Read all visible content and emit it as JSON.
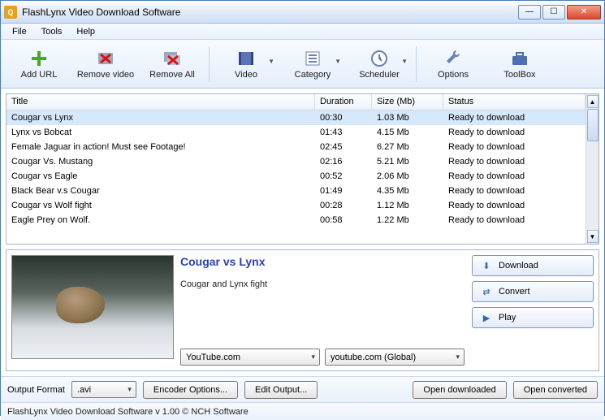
{
  "window": {
    "title": "FlashLynx Video Download Software"
  },
  "menu": {
    "file": "File",
    "tools": "Tools",
    "help": "Help"
  },
  "toolbar": {
    "add_url": "Add URL",
    "remove_video": "Remove video",
    "remove_all": "Remove All",
    "video": "Video",
    "category": "Category",
    "scheduler": "Scheduler",
    "options": "Options",
    "toolbox": "ToolBox"
  },
  "columns": {
    "title": "Title",
    "duration": "Duration",
    "size": "Size (Mb)",
    "status": "Status"
  },
  "rows": [
    {
      "title": "Cougar vs Lynx",
      "duration": "00:30",
      "size": "1.03 Mb",
      "status": "Ready to download",
      "selected": true
    },
    {
      "title": "Lynx vs Bobcat",
      "duration": "01:43",
      "size": "4.15 Mb",
      "status": "Ready to download"
    },
    {
      "title": "Female Jaguar in action! Must see Footage!",
      "duration": "02:45",
      "size": "6.27 Mb",
      "status": "Ready to download"
    },
    {
      "title": "Cougar Vs. Mustang",
      "duration": "02:16",
      "size": "5.21 Mb",
      "status": "Ready to download"
    },
    {
      "title": "Cougar vs Eagle",
      "duration": "00:52",
      "size": "2.06 Mb",
      "status": "Ready to download"
    },
    {
      "title": "Black Bear v.s Cougar",
      "duration": "01:49",
      "size": "4.35 Mb",
      "status": "Ready to download"
    },
    {
      "title": "Cougar vs Wolf fight",
      "duration": "00:28",
      "size": "1.12 Mb",
      "status": "Ready to download"
    },
    {
      "title": "Eagle Prey on Wolf.",
      "duration": "00:58",
      "size": "1.22 Mb",
      "status": "Ready to download"
    }
  ],
  "detail": {
    "title": "Cougar vs Lynx",
    "desc": "Cougar and Lynx fight",
    "source": "YouTube.com",
    "region": "youtube.com (Global)"
  },
  "actions": {
    "download": "Download",
    "convert": "Convert",
    "play": "Play"
  },
  "bottom": {
    "output_format_label": "Output Format",
    "output_format": ".avi",
    "encoder_options": "Encoder Options...",
    "edit_output": "Edit Output...",
    "open_downloaded": "Open downloaded",
    "open_converted": "Open converted"
  },
  "status": "FlashLynx Video Download Software v 1.00 © NCH Software"
}
